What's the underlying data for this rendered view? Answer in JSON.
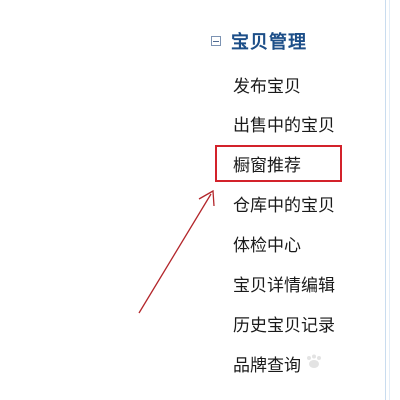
{
  "sidebar": {
    "section": {
      "title": "宝贝管理",
      "icon": "collapse-minus-icon"
    },
    "items": [
      {
        "label": "发布宝贝"
      },
      {
        "label": "出售中的宝贝"
      },
      {
        "label": "橱窗推荐",
        "highlighted": true
      },
      {
        "label": "仓库中的宝贝"
      },
      {
        "label": "体检中心"
      },
      {
        "label": "宝贝详情编辑"
      },
      {
        "label": "历史宝贝记录"
      },
      {
        "label": "品牌查询"
      }
    ]
  },
  "annotation": {
    "box_color": "#d3222b",
    "arrow_color": "#b3262b"
  },
  "colors": {
    "section_title": "#1c4e88",
    "item_text": "#1a1a1a",
    "separator": "#c9dcef"
  }
}
